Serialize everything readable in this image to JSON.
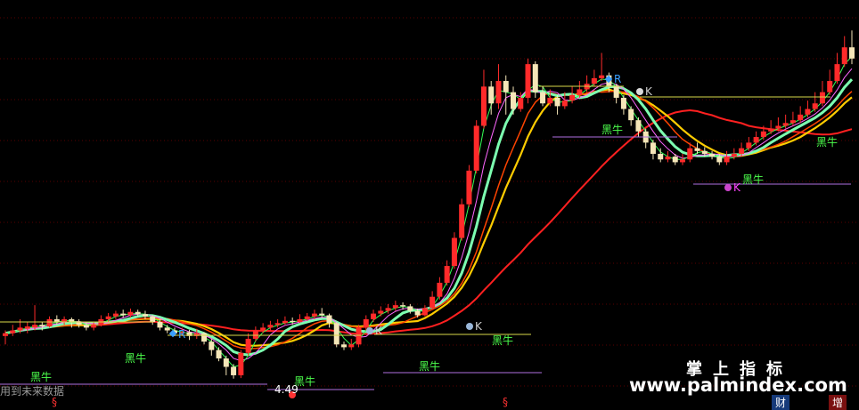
{
  "chart_data": {
    "type": "candlestick",
    "price_range": [
      4.2,
      10.8
    ],
    "grid": true,
    "low_label": "4.49",
    "signal_text": "黑牛",
    "k_marker": "K",
    "r_marker": "R",
    "candles": [
      [
        5.25,
        5.3,
        5.1,
        5.35
      ],
      [
        5.3,
        5.35,
        5.25,
        5.45
      ],
      [
        5.35,
        5.4,
        5.3,
        5.55
      ],
      [
        5.38,
        5.42,
        5.3,
        5.5
      ],
      [
        5.4,
        5.45,
        5.35,
        5.8
      ],
      [
        5.45,
        5.42,
        5.35,
        5.5
      ],
      [
        5.42,
        5.55,
        5.4,
        5.6
      ],
      [
        5.55,
        5.5,
        5.45,
        5.62
      ],
      [
        5.5,
        5.55,
        5.45,
        5.6
      ],
      [
        5.55,
        5.5,
        5.4,
        5.58
      ],
      [
        5.5,
        5.45,
        5.4,
        5.55
      ],
      [
        5.45,
        5.4,
        5.35,
        5.5
      ],
      [
        5.4,
        5.45,
        5.35,
        5.5
      ],
      [
        5.45,
        5.55,
        5.42,
        5.62
      ],
      [
        5.55,
        5.6,
        5.5,
        5.66
      ],
      [
        5.6,
        5.65,
        5.55,
        5.7
      ],
      [
        5.65,
        5.62,
        5.58,
        5.72
      ],
      [
        5.62,
        5.68,
        5.58,
        5.74
      ],
      [
        5.68,
        5.64,
        5.6,
        5.72
      ],
      [
        5.64,
        5.6,
        5.55,
        5.7
      ],
      [
        5.6,
        5.5,
        5.45,
        5.62
      ],
      [
        5.5,
        5.4,
        5.35,
        5.55
      ],
      [
        5.4,
        5.35,
        5.3,
        5.45
      ],
      [
        5.35,
        5.3,
        5.25,
        5.4
      ],
      [
        5.3,
        5.32,
        5.25,
        5.4
      ],
      [
        5.32,
        5.25,
        5.18,
        5.36
      ],
      [
        5.25,
        5.3,
        5.2,
        5.38
      ],
      [
        5.3,
        5.15,
        5.1,
        5.32
      ],
      [
        5.15,
        5.0,
        4.9,
        5.2
      ],
      [
        5.0,
        4.85,
        4.8,
        5.05
      ],
      [
        4.85,
        4.7,
        4.55,
        4.9
      ],
      [
        4.7,
        4.55,
        4.49,
        4.75
      ],
      [
        4.55,
        4.95,
        4.5,
        5.0
      ],
      [
        4.95,
        5.2,
        4.9,
        5.3
      ],
      [
        5.2,
        5.35,
        5.15,
        5.42
      ],
      [
        5.35,
        5.4,
        5.3,
        5.48
      ],
      [
        5.4,
        5.45,
        5.35,
        5.52
      ],
      [
        5.45,
        5.48,
        5.4,
        5.55
      ],
      [
        5.48,
        5.52,
        5.45,
        5.6
      ],
      [
        5.52,
        5.5,
        5.45,
        5.58
      ],
      [
        5.5,
        5.55,
        5.48,
        5.64
      ],
      [
        5.55,
        5.6,
        5.52,
        5.66
      ],
      [
        5.6,
        5.65,
        5.55,
        5.72
      ],
      [
        5.65,
        5.62,
        5.58,
        5.75
      ],
      [
        5.62,
        5.48,
        5.4,
        5.65
      ],
      [
        5.48,
        5.1,
        5.05,
        5.5
      ],
      [
        5.1,
        5.05,
        5.0,
        5.15
      ],
      [
        5.05,
        5.1,
        5.0,
        5.2
      ],
      [
        5.1,
        5.4,
        5.05,
        5.45
      ],
      [
        5.4,
        5.55,
        5.35,
        5.62
      ],
      [
        5.55,
        5.65,
        5.5,
        5.72
      ],
      [
        5.65,
        5.7,
        5.6,
        5.78
      ],
      [
        5.7,
        5.75,
        5.65,
        5.82
      ],
      [
        5.75,
        5.8,
        5.7,
        5.88
      ],
      [
        5.8,
        5.78,
        5.72,
        5.85
      ],
      [
        5.78,
        5.7,
        5.65,
        5.82
      ],
      [
        5.7,
        5.62,
        5.58,
        5.74
      ],
      [
        5.62,
        5.75,
        5.6,
        5.8
      ],
      [
        5.75,
        5.95,
        5.72,
        6.05
      ],
      [
        5.95,
        6.2,
        5.9,
        6.3
      ],
      [
        6.2,
        6.5,
        6.15,
        6.6
      ],
      [
        6.5,
        7.0,
        6.45,
        7.1
      ],
      [
        7.0,
        7.6,
        6.95,
        7.7
      ],
      [
        7.6,
        8.2,
        7.55,
        8.3
      ],
      [
        8.2,
        9.0,
        8.15,
        9.1
      ],
      [
        9.0,
        9.7,
        8.95,
        10.0
      ],
      [
        9.7,
        9.4,
        9.2,
        9.8
      ],
      [
        9.4,
        9.8,
        9.3,
        10.1
      ],
      [
        9.8,
        9.6,
        9.2,
        9.9
      ],
      [
        9.6,
        9.3,
        9.2,
        9.7
      ],
      [
        9.3,
        9.5,
        9.25,
        9.6
      ],
      [
        9.5,
        10.1,
        9.4,
        10.2
      ],
      [
        10.1,
        9.6,
        9.5,
        10.15
      ],
      [
        9.6,
        9.4,
        9.35,
        9.7
      ],
      [
        9.4,
        9.5,
        9.35,
        9.65
      ],
      [
        9.5,
        9.35,
        9.2,
        9.55
      ],
      [
        9.35,
        9.45,
        9.3,
        9.6
      ],
      [
        9.45,
        9.55,
        9.4,
        9.7
      ],
      [
        9.55,
        9.65,
        9.5,
        9.8
      ],
      [
        9.65,
        9.75,
        9.6,
        9.9
      ],
      [
        9.75,
        9.85,
        9.7,
        10.0
      ],
      [
        9.85,
        9.9,
        9.8,
        10.3
      ],
      [
        9.9,
        9.7,
        9.6,
        9.95
      ],
      [
        9.7,
        9.5,
        9.4,
        9.75
      ],
      [
        9.5,
        9.3,
        9.2,
        9.55
      ],
      [
        9.3,
        9.1,
        9.0,
        9.35
      ],
      [
        9.1,
        8.9,
        8.8,
        9.15
      ],
      [
        8.9,
        8.7,
        8.6,
        8.95
      ],
      [
        8.7,
        8.5,
        8.4,
        8.75
      ],
      [
        8.5,
        8.4,
        8.35,
        8.6
      ],
      [
        8.4,
        8.45,
        8.35,
        8.55
      ],
      [
        8.45,
        8.35,
        8.3,
        8.5
      ],
      [
        8.35,
        8.4,
        8.3,
        8.5
      ],
      [
        8.4,
        8.6,
        8.35,
        8.7
      ],
      [
        8.6,
        8.55,
        8.5,
        8.7
      ],
      [
        8.55,
        8.5,
        8.45,
        8.62
      ],
      [
        8.5,
        8.45,
        8.4,
        8.55
      ],
      [
        8.45,
        8.35,
        8.3,
        8.5
      ],
      [
        8.35,
        8.45,
        8.3,
        8.55
      ],
      [
        8.45,
        8.5,
        8.4,
        8.6
      ],
      [
        8.5,
        8.6,
        8.45,
        8.7
      ],
      [
        8.6,
        8.7,
        8.55,
        8.8
      ],
      [
        8.7,
        8.8,
        8.65,
        8.9
      ],
      [
        8.8,
        8.9,
        8.75,
        9.0
      ],
      [
        8.9,
        8.95,
        8.85,
        9.1
      ],
      [
        8.95,
        9.0,
        8.9,
        9.15
      ],
      [
        9.0,
        9.05,
        8.95,
        9.2
      ],
      [
        9.05,
        9.1,
        9.0,
        9.25
      ],
      [
        9.1,
        9.2,
        9.05,
        9.35
      ],
      [
        9.2,
        9.3,
        9.15,
        9.45
      ],
      [
        9.3,
        9.4,
        9.25,
        9.6
      ],
      [
        9.4,
        9.6,
        9.35,
        9.8
      ],
      [
        9.6,
        9.8,
        9.55,
        10.0
      ],
      [
        9.8,
        10.1,
        9.75,
        10.3
      ],
      [
        10.1,
        10.4,
        10.05,
        10.6
      ],
      [
        10.4,
        10.2,
        10.1,
        10.7
      ]
    ]
  },
  "labels": {
    "signal": "黑牛",
    "k": "K",
    "r": "R",
    "low_value": "4.49",
    "footer_left": "用到未来数据",
    "section_mark": "§",
    "watermark_cn": "掌上指标",
    "watermark_url": "www.palmindex.com",
    "tab_cai": "财",
    "tab_zeng": "增"
  }
}
